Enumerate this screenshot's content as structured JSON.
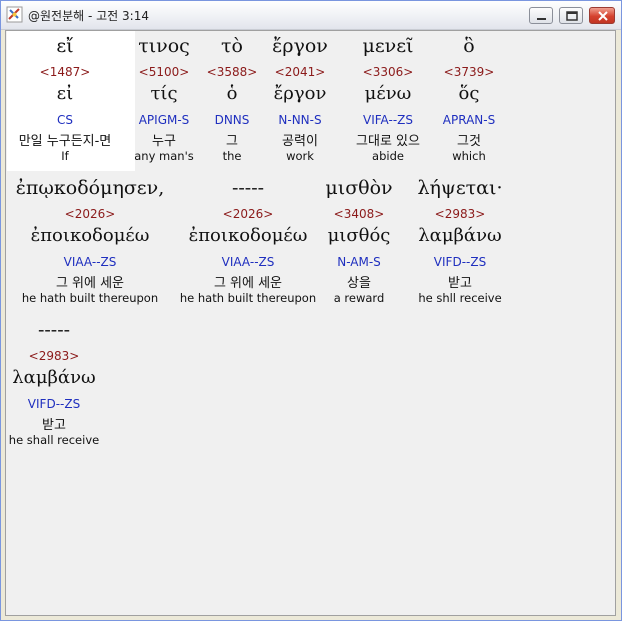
{
  "window": {
    "title": "@원전분해 - 고전 3:14"
  },
  "rows": [
    {
      "words": [
        {
          "greek": "εἴ",
          "strong": "<1487>",
          "lemma": "εἰ",
          "morph": "CS",
          "korean": "만일 누구든지-면",
          "english": "If"
        },
        {
          "greek": "τινος",
          "strong": "<5100>",
          "lemma": "τίς",
          "morph": "APIGM-S",
          "korean": "누구",
          "english": "any man's"
        },
        {
          "greek": "τὸ",
          "strong": "<3588>",
          "lemma": "ὁ",
          "morph": "DNNS",
          "korean": "그",
          "english": "the"
        },
        {
          "greek": "ἔργον",
          "strong": "<2041>",
          "lemma": "ἔργον",
          "morph": "N-NN-S",
          "korean": "공력이",
          "english": "work"
        },
        {
          "greek": "μενεῖ",
          "strong": "<3306>",
          "lemma": "μένω",
          "morph": "VIFA--ZS",
          "korean": "그대로 있으",
          "english": "abide"
        },
        {
          "greek": "ὃ",
          "strong": "<3739>",
          "lemma": "ὅς",
          "morph": "APRAN-S",
          "korean": "그것",
          "english": "which"
        }
      ]
    },
    {
      "words": [
        {
          "greek": "ἐπῳκοδόμησεν,",
          "strong": "<2026>",
          "lemma": "ἐποικοδομέω",
          "morph": "VIAA--ZS",
          "korean": "그 위에 세운",
          "english": "he hath built thereupon"
        },
        {
          "greek": "-----",
          "strong": "<2026>",
          "lemma": "ἐποικοδομέω",
          "morph": "VIAA--ZS",
          "korean": "그 위에 세운",
          "english": "he hath built thereupon"
        },
        {
          "greek": "μισθὸν",
          "strong": "<3408>",
          "lemma": "μισθός",
          "morph": "N-AM-S",
          "korean": "상을",
          "english": "a reward"
        },
        {
          "greek": "λήψεται·",
          "strong": "<2983>",
          "lemma": "λαμβάνω",
          "morph": "VIFD--ZS",
          "korean": "받고",
          "english": "he shll receive"
        }
      ]
    },
    {
      "words": [
        {
          "greek": "-----",
          "strong": "<2983>",
          "lemma": "λαμβάνω",
          "morph": "VIFD--ZS",
          "korean": "받고",
          "english": "he shall receive"
        }
      ]
    }
  ]
}
